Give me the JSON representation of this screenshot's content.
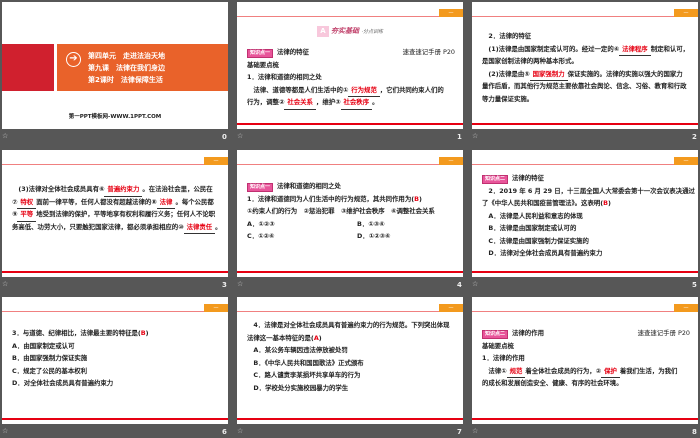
{
  "slides": [
    {
      "number": "0",
      "title": {
        "unit": "第四单元　走进法治天地",
        "lesson": "第九课　法律在我们身边",
        "period": "第2课时　法律保障生活"
      },
      "footer": "第一PPT模板网-WWW.1PPT.COM"
    },
    {
      "number": "1",
      "header": {
        "letter": "A",
        "title": "夯实基础",
        "sub": "·分点训练"
      },
      "lines": [
        [
          {
            "tag": "知识点一"
          },
          {
            "t": "法律的特征"
          },
          {
            "right": "速查速记手册 P20"
          }
        ],
        [
          {
            "t": "基础要点梳"
          }
        ],
        [
          {
            "t": "1．法律和道德的相同之处"
          }
        ],
        [
          {
            "t": "　法律、道德等都是人们生活中的①"
          },
          {
            "b": "行为规范"
          },
          {
            "t": "，它们共同约束人们的"
          }
        ],
        [
          {
            "t": "行为，调整②"
          },
          {
            "b": "社会关系"
          },
          {
            "t": "，维护③"
          },
          {
            "b": "社会秩序"
          },
          {
            "t": "。"
          }
        ]
      ]
    },
    {
      "number": "2",
      "lines": [
        [
          {
            "t": "　2．法律的特征"
          }
        ],
        [
          {
            "t": "　(1)法律是由国家制定或认可的。经过一定的④"
          },
          {
            "b": "法律程序"
          },
          {
            "t": "制定和认可，"
          }
        ],
        [
          {
            "t": "是国家创制法律的两种基本形式。"
          }
        ],
        [
          {
            "t": "　(2)法律是由⑤"
          },
          {
            "b": "国家强制力"
          },
          {
            "t": "保证实施的。法律的实施以强大的国家力"
          }
        ],
        [
          {
            "t": "量作后盾，而其他行为规范主要依靠社会舆论、信念、习俗、教育和行政"
          }
        ],
        [
          {
            "t": "等力量保证实施。"
          }
        ]
      ]
    },
    {
      "number": "3",
      "lines": [
        [
          {
            "t": "　(3)法律对全体社会成员具有⑥"
          },
          {
            "b": "普遍约束力"
          },
          {
            "t": "。在法治社会里，公民在"
          }
        ],
        [
          {
            "t": "⑦"
          },
          {
            "b": "特权"
          },
          {
            "t": "面前一律平等，任何人都没有超越法律的⑧"
          },
          {
            "b": "法律"
          },
          {
            "t": "。每个公民都"
          }
        ],
        [
          {
            "t": "⑨"
          },
          {
            "b": "平等"
          },
          {
            "t": "地受到法律的保护，平等地享有权利和履行义务；任何人不论职"
          }
        ],
        [
          {
            "t": "务高低、功劳大小，只要触犯国家法律，都必须承担相应的⑩"
          },
          {
            "b": "法律责任"
          },
          {
            "t": "。"
          }
        ]
      ]
    },
    {
      "number": "4",
      "lines": [
        [
          {
            "tag": "知识点一"
          },
          {
            "t": "法律和道德的相同之处"
          }
        ],
        [
          {
            "t": "1．法律和道德同为人们生活中的行为规范，其共同作用为("
          },
          {
            "r": "B"
          },
          {
            "t": ")"
          }
        ],
        [
          {
            "t": "①约束人们的行为　②惩治犯罪　③维护社会秩序　④调整社会关系"
          }
        ],
        [
          {
            "t": "A．①②③"
          },
          {
            "t2": "B．①③④"
          }
        ],
        [
          {
            "t": "C．①②④"
          },
          {
            "t2": "D．①②③④"
          }
        ]
      ]
    },
    {
      "number": "5",
      "lines": [
        [
          {
            "tag": "知识点二"
          },
          {
            "t": "法律的特征"
          }
        ],
        [
          {
            "t": "　2．2019 年 6 月 29 日，十三届全国人大常委会第十一次会议表决通过"
          }
        ],
        [
          {
            "t": "了《中华人民共和国疫苗管理法》。这表明("
          },
          {
            "r": "B"
          },
          {
            "t": ")"
          }
        ],
        [
          {
            "t": "　A．法律是人民利益和意志的体现"
          }
        ],
        [
          {
            "t": "　B．法律是由国家制定或认可的"
          }
        ],
        [
          {
            "t": "　C．法律是由国家强制力保证实施的"
          }
        ],
        [
          {
            "t": "　D．法律对全体社会成员具有普遍约束力"
          }
        ]
      ]
    },
    {
      "number": "6",
      "lines": [
        [
          {
            "t": "3．与道德、纪律相比，法律最主要的特征是("
          },
          {
            "r": "B"
          },
          {
            "t": ")"
          }
        ],
        [
          {
            "t": "A．由国家制定或认可"
          }
        ],
        [
          {
            "t": "B．由国家强制力保证实施"
          }
        ],
        [
          {
            "t": "C．规定了公民的基本权利"
          }
        ],
        [
          {
            "t": "D．对全体社会成员具有普遍约束力"
          }
        ]
      ]
    },
    {
      "number": "7",
      "lines": [
        [
          {
            "t": "　4．法律是对全体社会成员具有普遍约束力的行为规范。下列突出体现"
          }
        ],
        [
          {
            "t": "法律这一基本特征的是("
          },
          {
            "r": "A"
          },
          {
            "t": ")"
          }
        ],
        [
          {
            "t": "　A．某公务车辆因违法停放被处罚"
          }
        ],
        [
          {
            "t": "　B．《中华人民共和国国歌法》正式颁布"
          }
        ],
        [
          {
            "t": "　C．路人谴责李某损坏共享单车的行为"
          }
        ],
        [
          {
            "t": "　D．学校处分实施校园暴力的学生"
          }
        ]
      ]
    },
    {
      "number": "8",
      "lines": [
        [
          {
            "tag": "知识点二"
          },
          {
            "t": "法律的作用"
          },
          {
            "right": "速查速记手册 P20"
          }
        ],
        [
          {
            "t": "基础要点梳"
          }
        ],
        [
          {
            "t": "1．法律的作用"
          }
        ],
        [
          {
            "t": "　法律①"
          },
          {
            "b": "规范"
          },
          {
            "t": "着全体社会成员的行为，②"
          },
          {
            "b": "保护"
          },
          {
            "t": "着我们生活，为我们"
          }
        ],
        [
          {
            "t": "的成长和发展创造安全、健康、有序的社会环境。"
          }
        ]
      ]
    }
  ],
  "colors": {
    "accent_red": "#e60012",
    "orange": "#e9622a",
    "tag_pink": "#e8559a"
  },
  "icons": {
    "slide_star": "star-icon",
    "arrow": "arrow-right-circle-icon"
  },
  "star_glyph": "☆"
}
